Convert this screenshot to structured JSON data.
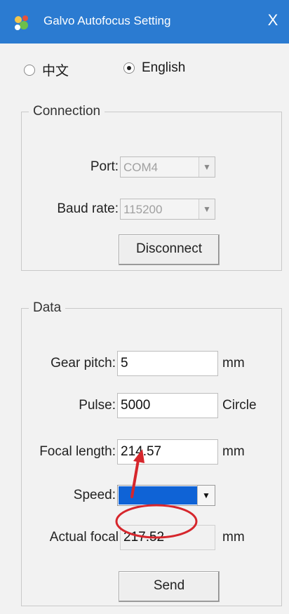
{
  "window": {
    "title": "Galvo Autofocus Setting",
    "close": "X"
  },
  "language": {
    "option_chinese": "中文",
    "option_english": "English",
    "selected": "English"
  },
  "connection": {
    "legend": "Connection",
    "port_label": "Port:",
    "port_value": "COM4",
    "baud_label": "Baud rate:",
    "baud_value": "115200",
    "disconnect_label": "Disconnect"
  },
  "data": {
    "legend": "Data",
    "gear_pitch_label": "Gear pitch:",
    "gear_pitch_value": "5",
    "gear_pitch_unit": "mm",
    "pulse_label": "Pulse:",
    "pulse_value": "5000",
    "pulse_unit": "Circle",
    "focal_length_label": "Focal length:",
    "focal_length_value": "214.57",
    "focal_length_unit": "mm",
    "speed_label": "Speed:",
    "actual_focal_label": "Actual focal",
    "actual_focal_value": "217.52",
    "actual_focal_unit": "mm",
    "send_label": "Send"
  },
  "icons": {
    "app": "app-icon",
    "dropdown": "chevron-down-icon"
  },
  "colors": {
    "titlebar": "#2b7bd1",
    "annotation": "#d6262c",
    "selection": "#0f63d6"
  }
}
